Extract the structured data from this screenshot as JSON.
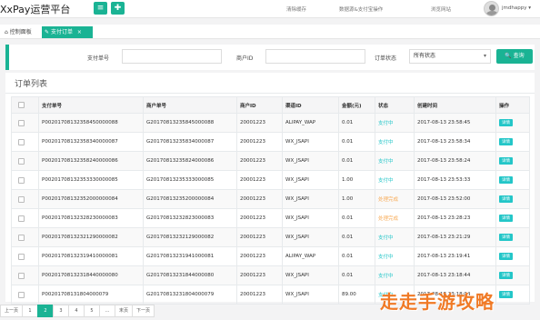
{
  "header": {
    "brand": "XxPay运营平台",
    "menu_icon": "menu-icon",
    "fullscreen_icon": "expand-icon",
    "links": [
      "清除缓存",
      "数据源&支付宝操作",
      "浏览网站"
    ],
    "username": "jmdhappy",
    "user_caret": "▾"
  },
  "tabs": [
    {
      "label": "控制面板",
      "icon": "home-icon",
      "active": false
    },
    {
      "label": "支付订单",
      "icon": "edit-icon",
      "active": true,
      "close": "×"
    }
  ],
  "search": {
    "pay_no_label": "支付单号",
    "pay_no_value": "",
    "mch_id_label": "商户ID",
    "mch_id_value": "",
    "status_label": "订单状态",
    "status_selected": "所有状态",
    "search_button": "🔍 查询"
  },
  "list": {
    "title": "订单列表",
    "columns": [
      "",
      "支付单号",
      "商户单号",
      "商户ID",
      "渠道ID",
      "金额(元)",
      "状态",
      "创建时间",
      "操作"
    ],
    "rows": [
      [
        "P00201708132358450000088",
        "G20170813235845000088",
        "20001223",
        "ALIPAY_WAP",
        "0.01",
        "支付中",
        "2017-08-13 23:58:45",
        "详情"
      ],
      [
        "P00201708132358340000087",
        "G20170813235834000087",
        "20001223",
        "WX_JSAPI",
        "0.01",
        "支付中",
        "2017-08-13 23:58:34",
        "详情"
      ],
      [
        "P00201708132358240000086",
        "G20170813235824000086",
        "20001223",
        "WX_JSAPI",
        "0.01",
        "支付中",
        "2017-08-13 23:58:24",
        "详情"
      ],
      [
        "P00201708132353330000085",
        "G20170813235333000085",
        "20001223",
        "WX_JSAPI",
        "1.00",
        "支付中",
        "2017-08-13 23:53:33",
        "详情"
      ],
      [
        "P00201708132352000000084",
        "G20170813235200000084",
        "20001223",
        "WX_JSAPI",
        "1.00",
        "处理完成",
        "2017-08-13 23:52:00",
        "详情"
      ],
      [
        "P00201708132328230000083",
        "G20170813232823000083",
        "20001223",
        "WX_JSAPI",
        "0.01",
        "处理完成",
        "2017-08-13 23:28:23",
        "详情"
      ],
      [
        "P00201708132321290000082",
        "G20170813232129000082",
        "20001223",
        "WX_JSAPI",
        "0.01",
        "支付中",
        "2017-08-13 23:21:29",
        "详情"
      ],
      [
        "P00201708132319410000081",
        "G20170813231941000081",
        "20001223",
        "ALIPAY_WAP",
        "0.01",
        "支付中",
        "2017-08-13 23:19:41",
        "详情"
      ],
      [
        "P00201708132318440000080",
        "G20170813231844000080",
        "20001223",
        "WX_JSAPI",
        "0.01",
        "支付中",
        "2017-08-13 23:18:44",
        "详情"
      ],
      [
        "P00201708131804000079",
        "G20170813231804000079",
        "20001223",
        "WX_JSAPI",
        "89.00",
        "支付中",
        "2017-08-13 23:18:04",
        "详情"
      ]
    ]
  },
  "pagination": [
    "上一页",
    "1",
    "2",
    "3",
    "4",
    "5",
    "…",
    "末页",
    "下一页"
  ],
  "pagination_active": "2",
  "watermark": "走走手游攻略",
  "colors": {
    "accent": "#1ab394",
    "info": "#23c6c8",
    "warning": "#f8ac59"
  }
}
